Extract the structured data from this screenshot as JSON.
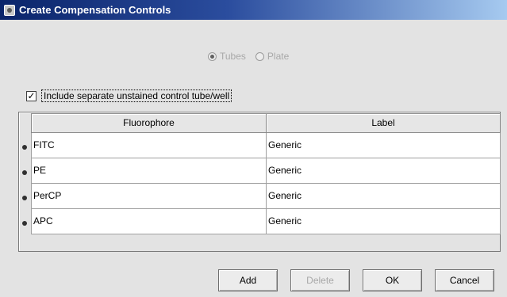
{
  "window": {
    "title": "Create Compensation Controls"
  },
  "mode": {
    "options": [
      {
        "label": "Tubes",
        "selected": true,
        "enabled": false
      },
      {
        "label": "Plate",
        "selected": false,
        "enabled": false
      }
    ]
  },
  "unstained": {
    "label": "Include separate unstained control tube/well",
    "checked": true,
    "check_mark": "✓"
  },
  "table": {
    "columns": [
      "Fluorophore",
      "Label"
    ],
    "rows": [
      {
        "fluorophore": "FITC",
        "label": "Generic"
      },
      {
        "fluorophore": "PE",
        "label": "Generic"
      },
      {
        "fluorophore": "PerCP",
        "label": "Generic"
      },
      {
        "fluorophore": "APC",
        "label": "Generic"
      }
    ]
  },
  "buttons": {
    "add": "Add",
    "delete": "Delete",
    "ok": "OK",
    "cancel": "Cancel"
  },
  "colors": {
    "title_gradient_start": "#0a246a",
    "title_gradient_end": "#a6caf0",
    "window_bg": "#e3e3e3",
    "disabled_text": "#a8a8a8"
  }
}
